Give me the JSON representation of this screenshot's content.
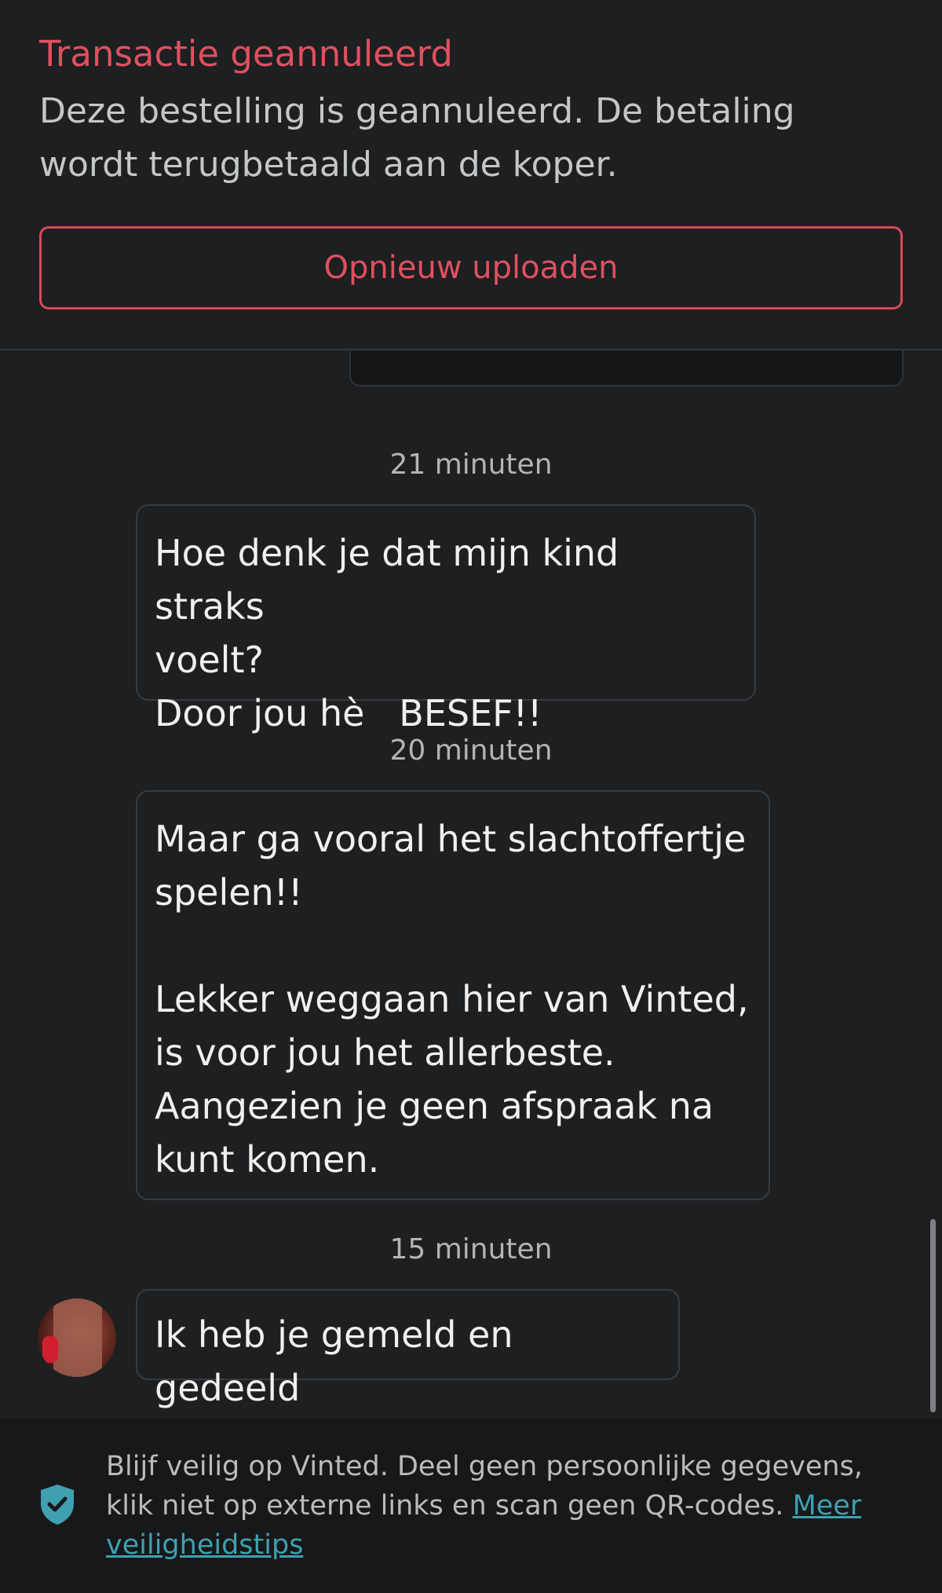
{
  "banner": {
    "title": "Transactie geannuleerd",
    "description": "Deze bestelling is geannuleerd. De betaling wordt terugbetaald aan de koper.",
    "button_label": "Opnieuw uploaden"
  },
  "messages": [
    {
      "timestamp": "21 minuten",
      "text": "Hoe denk je dat mijn kind straks\nvoelt?\nDoor jou hè   BESEF!!"
    },
    {
      "timestamp": "20 minuten",
      "text": "Maar ga vooral het slachtoffertje\nspelen!!\n\nLekker weggaan hier van Vinted,\nis voor jou het allerbeste.\nAangezien je geen afspraak na\nkunt komen."
    },
    {
      "timestamp": "15 minuten",
      "text": "Ik heb je gemeld en gedeeld"
    }
  ],
  "footer": {
    "text": "Blijf veilig op Vinted. Deel geen persoonlijke gegevens, klik niet op externe links en scan geen QR-codes. ",
    "link_label": "Meer veiligheidstips",
    "icon": "shield-check-icon"
  },
  "colors": {
    "accent_red": "#e0505f",
    "link_teal": "#3fa0b0",
    "background": "#1d1f21"
  }
}
